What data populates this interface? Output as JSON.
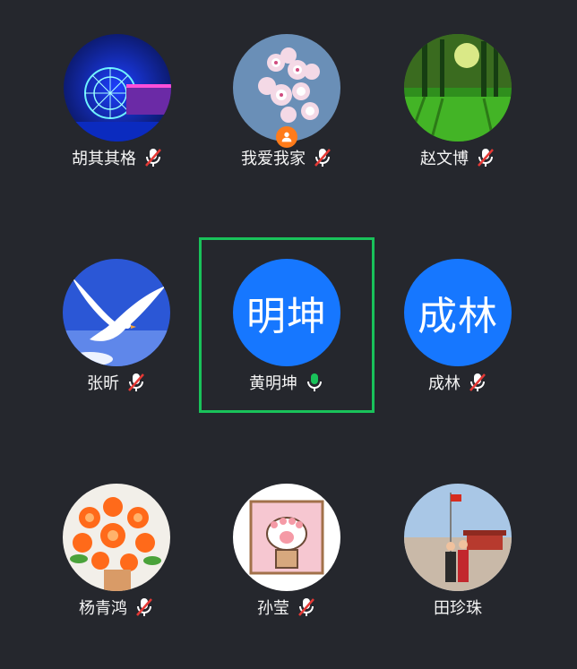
{
  "participants": [
    {
      "name": "胡其其格",
      "mic": "muted",
      "avatar": "ferris-wheel-photo"
    },
    {
      "name": "我爱我家",
      "mic": "muted",
      "avatar": "cherry-blossom-photo",
      "host": true
    },
    {
      "name": "赵文博",
      "mic": "muted",
      "avatar": "green-forest-photo"
    },
    {
      "name": "张昕",
      "mic": "muted",
      "avatar": "white-dove-photo"
    },
    {
      "name": "黄明坤",
      "mic": "on",
      "avatar_text": "明坤",
      "active": true
    },
    {
      "name": "成林",
      "mic": "muted",
      "avatar_text": "成林"
    },
    {
      "name": "杨青鸿",
      "mic": "muted",
      "avatar": "orange-flowers-photo"
    },
    {
      "name": "孙莹",
      "mic": "muted",
      "avatar": "cat-paw-cartoon"
    },
    {
      "name": "田珍珠",
      "mic": "none",
      "avatar": "tiananmen-photo"
    }
  ],
  "colors": {
    "background": "#25272d",
    "text_avatar": "#1677ff",
    "active_border": "#19c25a",
    "mic_on": "#19c25a",
    "mic_muted_slash": "#e53935",
    "host_badge": "#ff7b1a"
  }
}
